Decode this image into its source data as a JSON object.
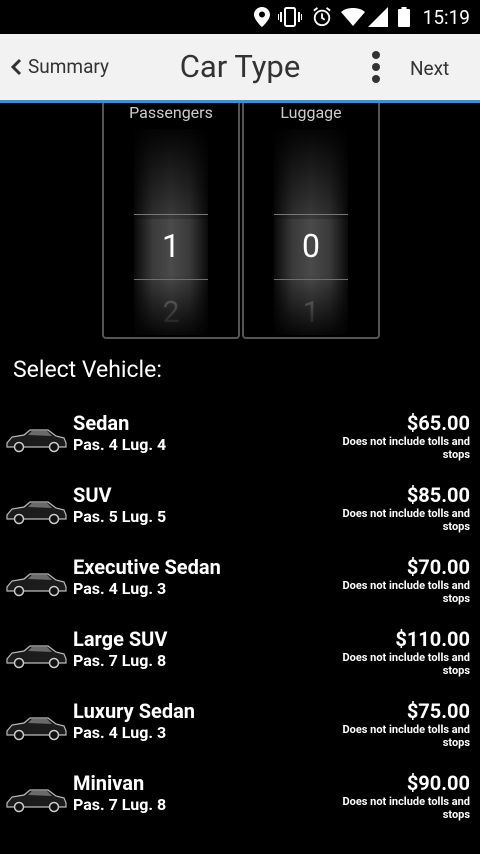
{
  "status_bar": {
    "time": "15:19"
  },
  "action_bar": {
    "back_label": "Summary",
    "title": "Car Type",
    "next_label": "Next"
  },
  "pickers": [
    {
      "label": "Passengers",
      "selected": "1",
      "next": "2"
    },
    {
      "label": "Luggage",
      "selected": "0",
      "next": "1"
    }
  ],
  "section_title": "Select Vehicle:",
  "vehicles": [
    {
      "name": "Sedan",
      "capacity": "Pas. 4 Lug. 4",
      "price": "$65.00",
      "note": "Does not include tolls and stops",
      "icon": "sedan-car-icon"
    },
    {
      "name": "SUV",
      "capacity": "Pas. 5 Lug. 5",
      "price": "$85.00",
      "note": "Does not include tolls and stops",
      "icon": "suv-car-icon"
    },
    {
      "name": "Executive Sedan",
      "capacity": "Pas. 4 Lug. 3",
      "price": "$70.00",
      "note": "Does not include tolls and stops",
      "icon": "executive-sedan-car-icon"
    },
    {
      "name": "Large SUV",
      "capacity": "Pas. 7 Lug. 8",
      "price": "$110.00",
      "note": "Does not include tolls and stops",
      "icon": "large-suv-car-icon"
    },
    {
      "name": "Luxury Sedan",
      "capacity": "Pas. 4 Lug. 3",
      "price": "$75.00",
      "note": "Does not include tolls and stops",
      "icon": "luxury-sedan-car-icon"
    },
    {
      "name": "Minivan",
      "capacity": "Pas. 7 Lug. 8",
      "price": "$90.00",
      "note": "Does not include tolls and stops",
      "icon": "minivan-car-icon"
    }
  ]
}
